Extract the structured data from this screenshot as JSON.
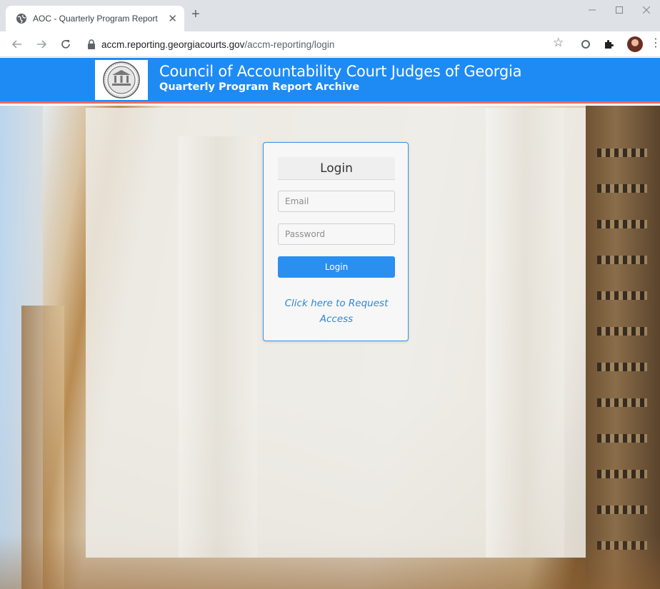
{
  "browser": {
    "tab_title": "AOC - Quarterly Program Report",
    "tab_close": "✕",
    "new_tab": "+",
    "url_host": "accm.reporting.georgiacourts.gov",
    "url_path": "/accm-reporting/login",
    "icons": {
      "back": "back-arrow-icon",
      "forward": "forward-arrow-icon",
      "reload": "reload-icon",
      "lock": "lock-icon",
      "bookmark": "star-icon",
      "extensions": [
        "circle-extension-icon",
        "puzzle-icon"
      ],
      "menu": "menu-dots-icon"
    }
  },
  "header": {
    "title": "Council of Accountability Court Judges of Georgia",
    "subtitle": "Quarterly Program Report Archive"
  },
  "login": {
    "heading": "Login",
    "email_placeholder": "Email",
    "password_placeholder": "Password",
    "button_label": "Login",
    "request_access_label": "Click here to Request Access"
  },
  "colors": {
    "header_bg": "#1e8bf5",
    "header_accent": "#f0685b",
    "button_bg": "#2b8ff0",
    "link": "#2f86dc"
  }
}
